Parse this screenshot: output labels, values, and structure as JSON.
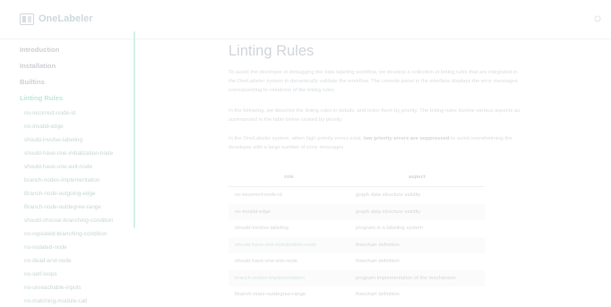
{
  "header": {
    "brand": "OneLabeler"
  },
  "sidebar": {
    "items": [
      {
        "label": "Introduction"
      },
      {
        "label": "Installation"
      },
      {
        "label": "Builtins"
      },
      {
        "label": "Linting Rules"
      }
    ],
    "subitems": [
      {
        "label": "no-incorrect-node-id"
      },
      {
        "label": "no-invalid-edge"
      },
      {
        "label": "should-involve-labeling"
      },
      {
        "label": "should-have-one-initialization-node"
      },
      {
        "label": "should-have-one-exit-node"
      },
      {
        "label": "branch-nodes-implementation"
      },
      {
        "label": "Branch-node-outgoing-edge"
      },
      {
        "label": "Branch-node-outdegree-range"
      },
      {
        "label": "should-choose-branching-condition"
      },
      {
        "label": "no-repeated-branching-condition"
      },
      {
        "label": "no-isolated-node"
      },
      {
        "label": "no-dead-end-node"
      },
      {
        "label": "no-self-loops"
      },
      {
        "label": "no-unreachable-inputs"
      },
      {
        "label": "no-matching-module-call"
      }
    ]
  },
  "main": {
    "title": "Linting Rules",
    "para1": "To assist the developer in debugging the data labeling workflow, we develop a collection of linting rules that are integrated in the OneLabeler system to dynamically validate the workflow. The console panel in the interface displays the error messages corresponding to violations of the linting rules.",
    "para2": "In the following, we describe the linting rules in details, and order them by priority. The linting rules involve various aspects as summarized in the table below ranked by priority.",
    "para3_pre": "In the OneLabeler system, when high priority errors exist,",
    "para3_bold": "low priority errors are suppressed",
    "para3_post": "to avoid overwhelming the developer with a large number of error messages.",
    "table": {
      "headers": [
        "rule",
        "aspect"
      ],
      "rows": [
        [
          "no-incorrect-node-id",
          "graph data structure validity"
        ],
        [
          "no-invalid-edge",
          "graph data structure validity"
        ],
        [
          "should-involve-labeling",
          "program is a labeling system"
        ],
        [
          "should-have-one-initialization-node",
          "flowchart definition"
        ],
        [
          "should-have-one-exit-node",
          "flowchart definition"
        ],
        [
          "branch-nodes-implementation",
          "program implementation of the mechanism"
        ],
        [
          "Branch-node-outdegree-range",
          "flowchart definition"
        ]
      ]
    }
  }
}
